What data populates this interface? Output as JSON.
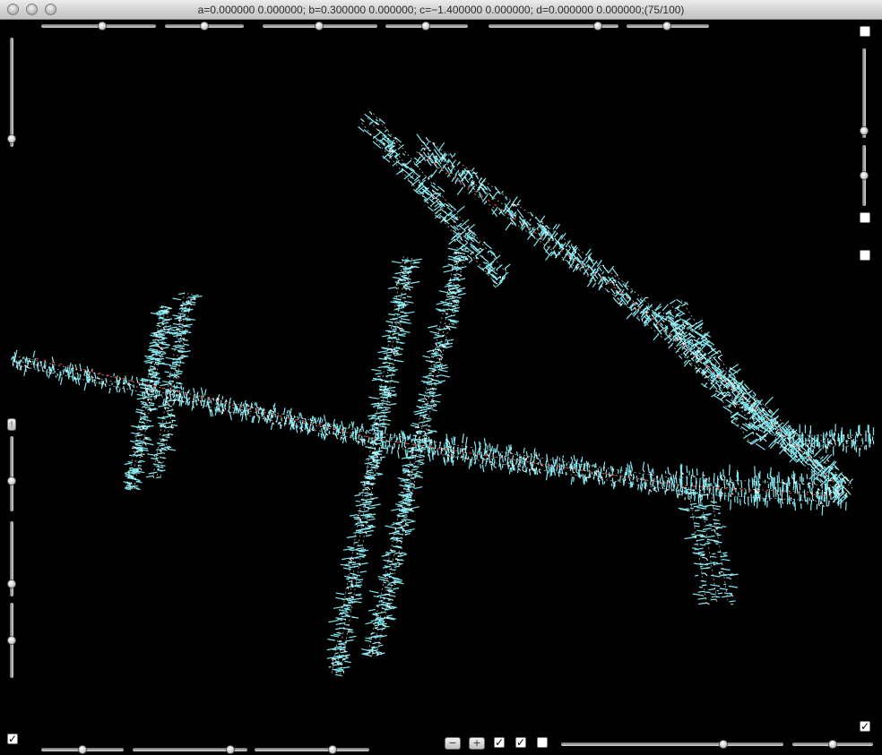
{
  "window": {
    "title": "a=0.000000 0.000000; b=0.300000 0.000000; c=−1.400000 0.000000; d=0.000000 0.000000;(75/100)"
  },
  "colors": {
    "background": "#000000",
    "fractal_primary": "#7fe6ee",
    "fractal_secondary": "#ffffff",
    "fractal_accent": "#e0302a"
  },
  "controls": {
    "top_sliders": [
      {
        "name": "param-slider-1",
        "value": 0.5
      },
      {
        "name": "param-slider-2",
        "value": 0.5
      },
      {
        "name": "param-slider-3",
        "value": 0.5
      },
      {
        "name": "param-slider-4",
        "value": 0.5
      },
      {
        "name": "param-slider-5",
        "value": 0.85
      },
      {
        "name": "param-slider-6",
        "value": 0.5
      }
    ],
    "bottom_sliders": [
      {
        "name": "bottom-slider-1",
        "value": 0.5
      },
      {
        "name": "bottom-slider-2",
        "value": 0.85
      },
      {
        "name": "bottom-slider-3",
        "value": 0.7
      },
      {
        "name": "zoom-slider",
        "value": 0.73
      },
      {
        "name": "detail-slider",
        "value": 0.6
      }
    ],
    "minus_label": "−",
    "plus_label": "+",
    "checkboxes": {
      "bottom_left": true,
      "bottom_1": true,
      "bottom_2": true,
      "bottom_3": false,
      "bottom_right": true,
      "right_top": false,
      "right_mid": false,
      "right_upper_mid": false
    }
  }
}
